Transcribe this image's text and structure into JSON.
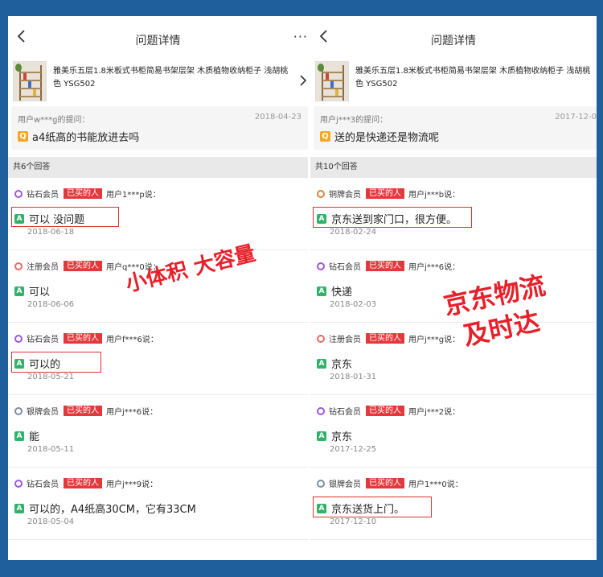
{
  "left": {
    "title": "问题详情",
    "more": "···",
    "product": {
      "title": "雅美乐五层1.8米板式书柜简易书架层架 木质植物收纳柜子 浅胡桃色 YSG502"
    },
    "question": {
      "user": "用户w***g的提问：",
      "date": "2018-04-23",
      "badge": "Q",
      "text": "a4纸高的书能放进去吗"
    },
    "count": "共6个回答",
    "answers": [
      {
        "member": "钻石会员",
        "tag": "已买的人",
        "user": "用户1***p说：",
        "badge": "A",
        "text": "可以 没问题",
        "date": "2018-06-18"
      },
      {
        "member": "注册会员",
        "tag": "已买的人",
        "user": "用户q***0说：",
        "badge": "A",
        "text": "可以",
        "date": "2018-06-06"
      },
      {
        "member": "钻石会员",
        "tag": "已买的人",
        "user": "用户f***6说：",
        "badge": "A",
        "text": "可以的",
        "date": "2018-05-21"
      },
      {
        "member": "银牌会员",
        "tag": "已买的人",
        "user": "用户j***6说：",
        "badge": "A",
        "text": "能",
        "date": "2018-05-11"
      },
      {
        "member": "钻石会员",
        "tag": "已买的人",
        "user": "用户j***9说：",
        "badge": "A",
        "text": "可以的，A4纸高30CM，它有33CM",
        "date": "2018-05-04"
      }
    ]
  },
  "right": {
    "title": "问题详情",
    "product": {
      "title": "雅美乐五层1.8米板式书柜简易书架层架 木质植物收纳柜子 浅胡桃色 YSG502"
    },
    "question": {
      "user": "用户j***3的提问：",
      "date": "2017-12-0",
      "badge": "Q",
      "text": "送的是快递还是物流呢"
    },
    "count": "共10个回答",
    "answers": [
      {
        "member": "铜牌会员",
        "tag": "已买的人",
        "user": "用户j***b说：",
        "badge": "A",
        "text": "京东送到家门口，很方便。",
        "date": "2018-02-24"
      },
      {
        "member": "钻石会员",
        "tag": "已买的人",
        "user": "用户j***6说：",
        "badge": "A",
        "text": "快递",
        "date": "2018-02-03"
      },
      {
        "member": "注册会员",
        "tag": "已买的人",
        "user": "用户j***g说：",
        "badge": "A",
        "text": "京东",
        "date": "2018-01-31"
      },
      {
        "member": "钻石会员",
        "tag": "已买的人",
        "user": "用户j***2说：",
        "badge": "A",
        "text": "京东",
        "date": "2017-12-25"
      },
      {
        "member": "银牌会员",
        "tag": "已买的人",
        "user": "用户1***0说：",
        "badge": "A",
        "text": "京东送货上门。",
        "date": "2017-12-10"
      }
    ]
  },
  "overlays": {
    "left_slogan": "小体积 大容量",
    "right_slogan_line1": "京东物流",
    "right_slogan_line2": "及时达"
  },
  "colors": {
    "background": "#1f5f9c",
    "bought_tag": "#e4393c",
    "answer_badge": "#32b16c",
    "question_badge": "#f5a623",
    "highlight": "#d8352f",
    "slogan": "#e8202a",
    "diamond": "#9b59d6",
    "register": "#e86a6a",
    "silver": "#7a8fa6",
    "bronze": "#d7853a"
  }
}
